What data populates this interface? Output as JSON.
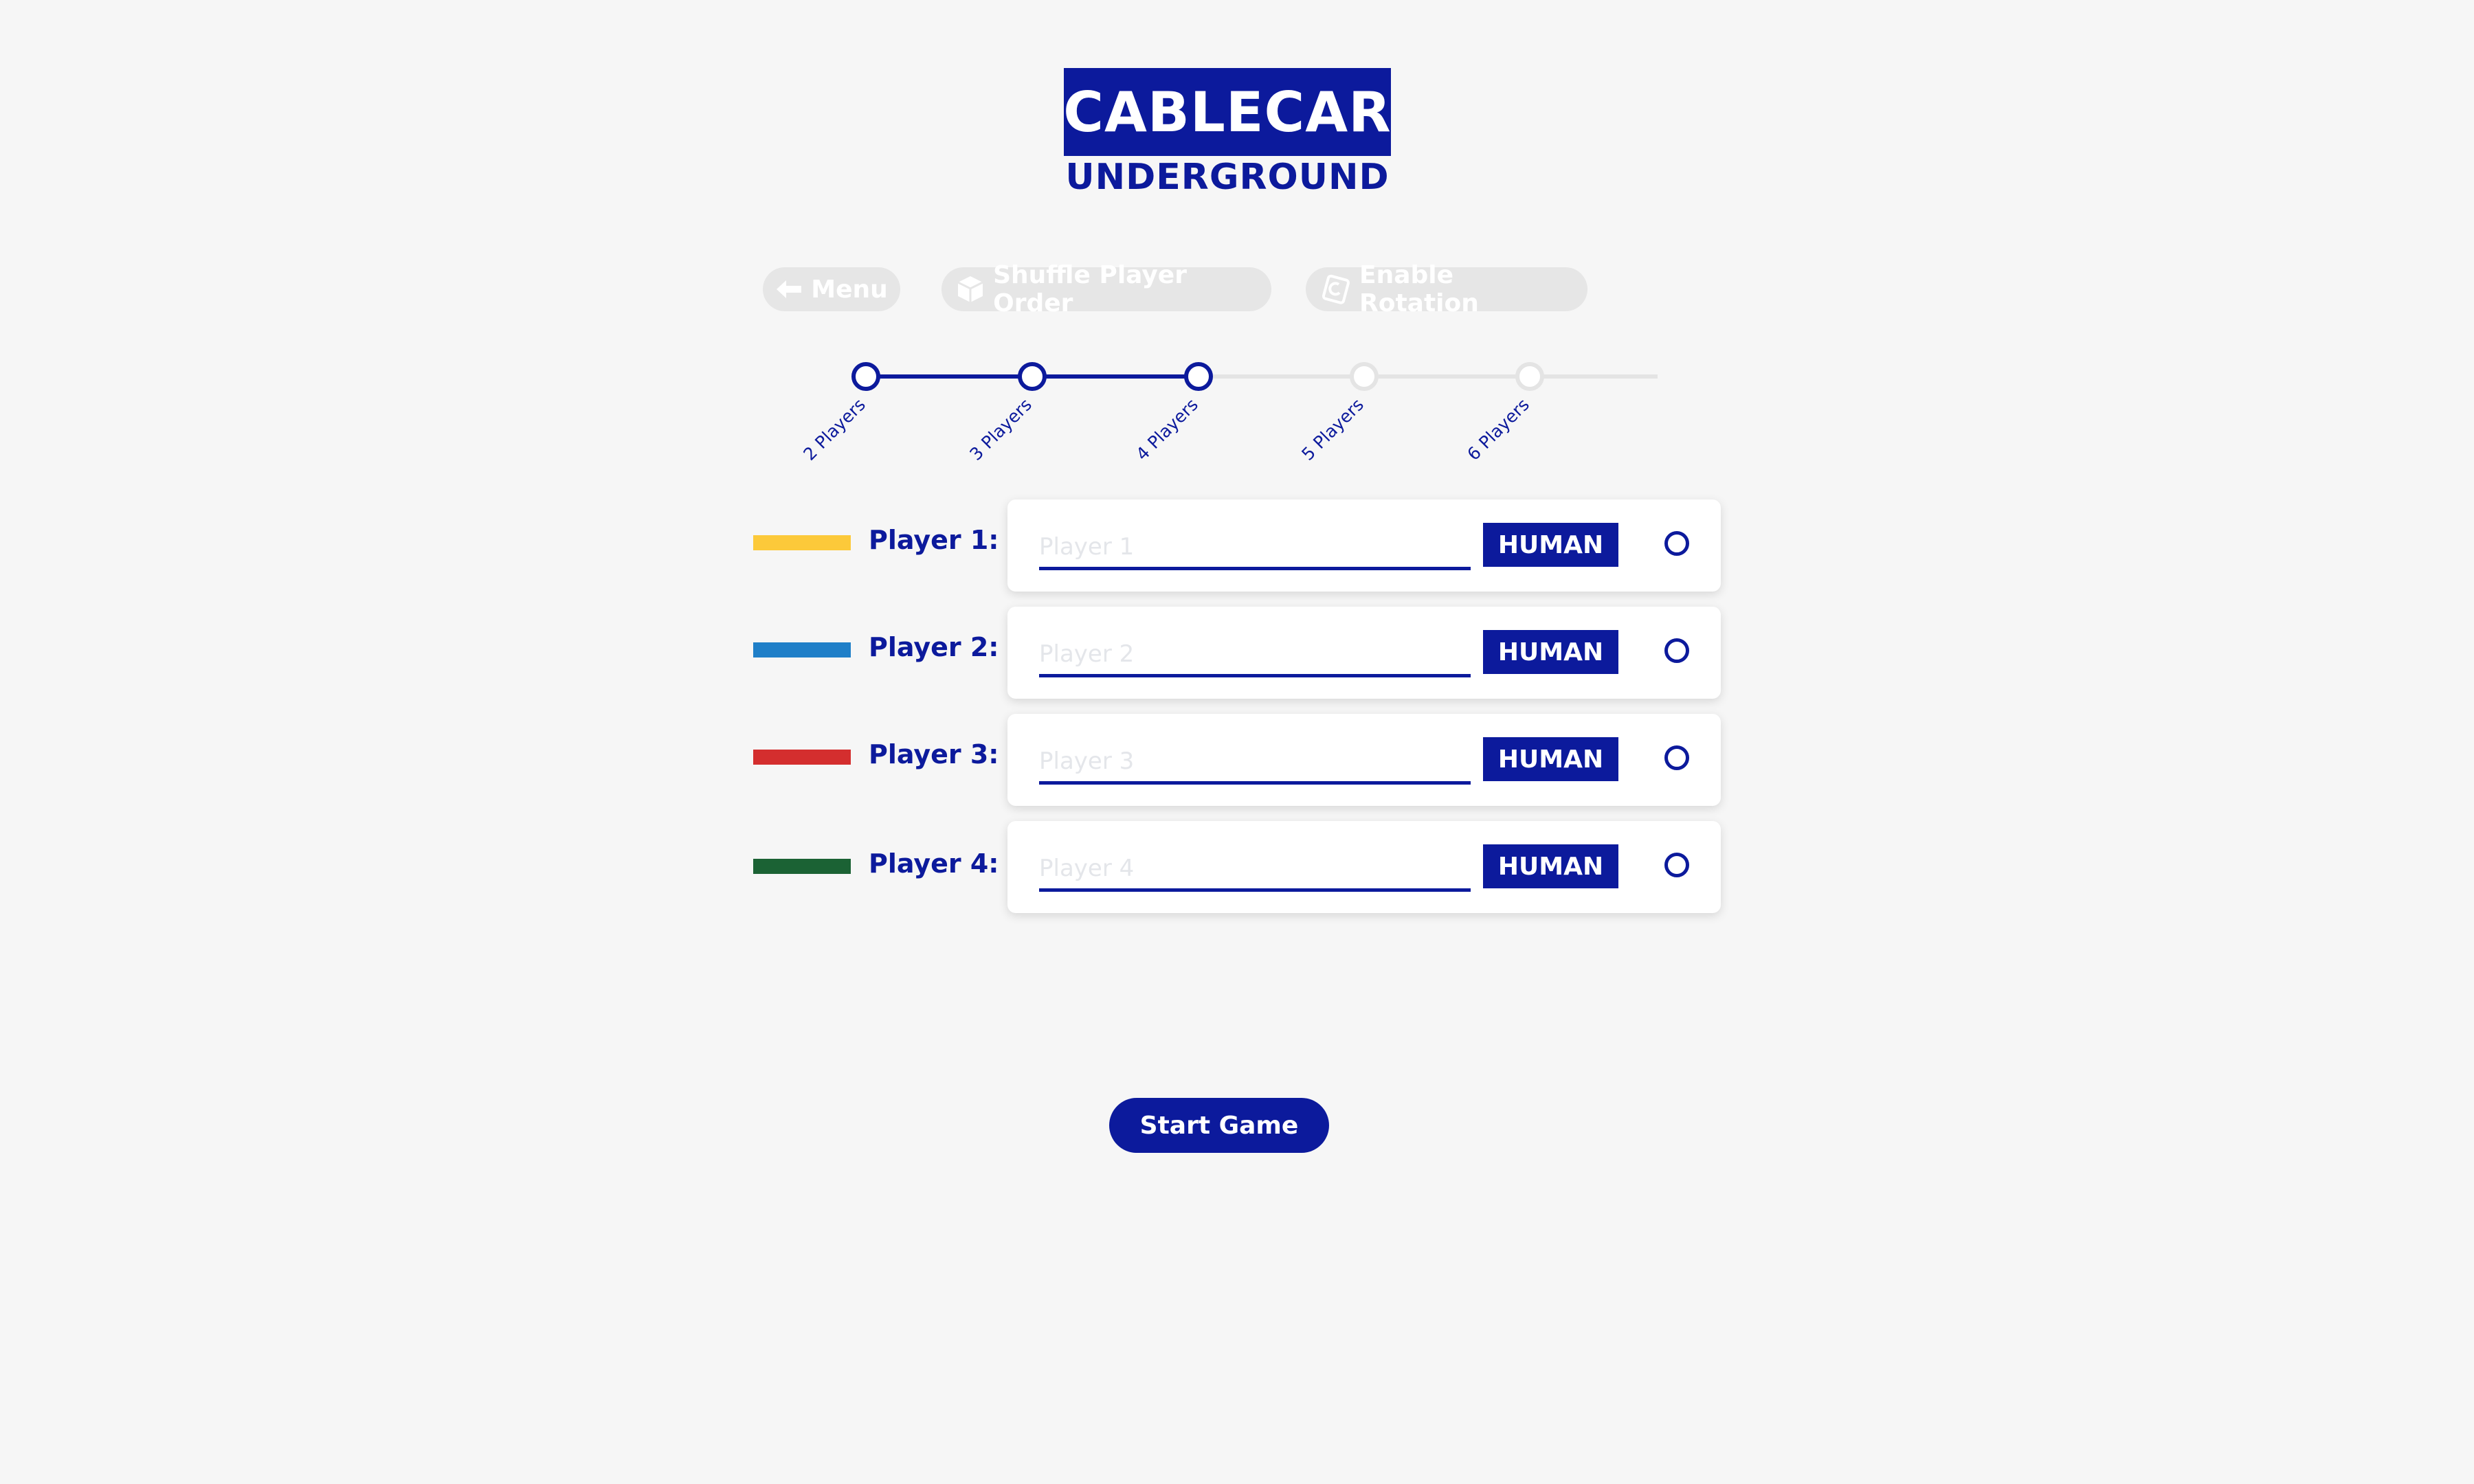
{
  "logo": {
    "title": "CABLECAR",
    "subtitle": "UNDERGROUND"
  },
  "toolbar": {
    "menu": {
      "label": "Menu",
      "icon": "arrow-left-icon"
    },
    "shuffle": {
      "label": "Shuffle Player Order",
      "icon": "dice-icon"
    },
    "rotation": {
      "label": "Enable Rotation",
      "icon": "rotation-icon"
    }
  },
  "player_count": {
    "steps": [
      {
        "label": "2 Players",
        "active": true
      },
      {
        "label": "3 Players",
        "active": true
      },
      {
        "label": "4 Players",
        "active": true
      },
      {
        "label": "5 Players",
        "active": false
      },
      {
        "label": "6 Players",
        "active": false
      }
    ],
    "selected": "4 Players"
  },
  "players": [
    {
      "label": "Player 1:",
      "color": "#fcc93a",
      "placeholder": "Player 1",
      "value": "",
      "type": "HUMAN"
    },
    {
      "label": "Player 2:",
      "color": "#1f7fc8",
      "placeholder": "Player 2",
      "value": "",
      "type": "HUMAN"
    },
    {
      "label": "Player 3:",
      "color": "#d42e2e",
      "placeholder": "Player 3",
      "value": "",
      "type": "HUMAN"
    },
    {
      "label": "Player 4:",
      "color": "#1b6234",
      "placeholder": "Player 4",
      "value": "",
      "type": "HUMAN"
    }
  ],
  "start_button": {
    "label": "Start Game"
  },
  "colors": {
    "accent": "#0c1a9c",
    "background": "#f6f6f6",
    "disabled": "#e6e6e6"
  }
}
